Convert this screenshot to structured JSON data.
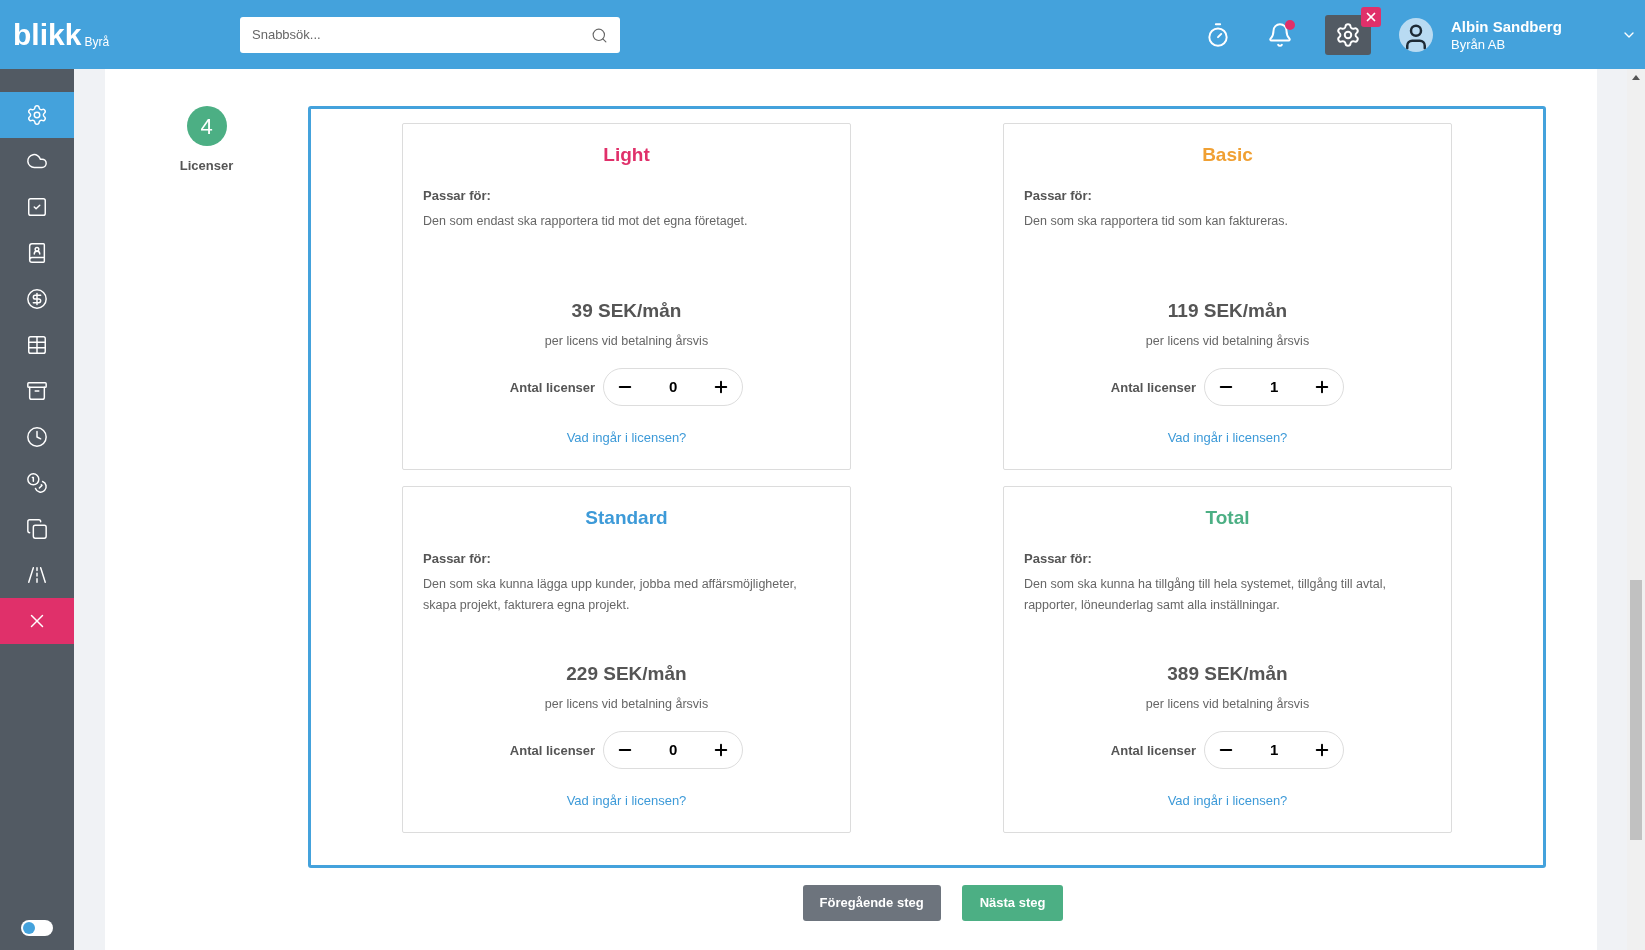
{
  "header": {
    "logo": "blikk",
    "logo_suffix": "Byrå",
    "search": {
      "placeholder": "Snabbsök..."
    },
    "notifications_unread": true,
    "settings_active": true,
    "user": {
      "name": "Albin Sandberg",
      "company": "Byrån AB"
    }
  },
  "sidebar": {
    "items": [
      {
        "kind": "settings",
        "selected": true
      },
      {
        "kind": "cloud",
        "selected": false
      },
      {
        "kind": "task",
        "selected": false
      },
      {
        "kind": "contacts",
        "selected": false
      },
      {
        "kind": "money",
        "selected": false
      },
      {
        "kind": "table",
        "selected": false
      },
      {
        "kind": "archive",
        "selected": false
      },
      {
        "kind": "clock",
        "selected": false
      },
      {
        "kind": "coins",
        "selected": false
      },
      {
        "kind": "copy",
        "selected": false
      },
      {
        "kind": "road",
        "selected": false
      },
      {
        "kind": "close",
        "selected": false
      }
    ],
    "toggle": {
      "on": false
    }
  },
  "step": {
    "number": "4",
    "label": "Licenser"
  },
  "plans": [
    {
      "name": "Light",
      "color": "#e0306a",
      "fit_label": "Passar för:",
      "description": "Den som endast ska rapportera tid mot det egna företaget.",
      "price": "39 SEK/mån",
      "note": "per licens vid betalning årsvis",
      "quantity_label": "Antal licenser",
      "quantity": "0",
      "link": "Vad ingår i licensen?"
    },
    {
      "name": "Basic",
      "color": "#f0a033",
      "fit_label": "Passar för:",
      "description": "Den som ska rapportera tid som kan faktureras.",
      "price": "119 SEK/mån",
      "note": "per licens vid betalning årsvis",
      "quantity_label": "Antal licenser",
      "quantity": "1",
      "link": "Vad ingår i licensen?"
    },
    {
      "name": "Standard",
      "color": "#3d9ad8",
      "fit_label": "Passar för:",
      "description": "Den som ska kunna lägga upp kunder, jobba med affärsmöjligheter, skapa projekt, fakturera egna projekt.",
      "price": "229 SEK/mån",
      "note": "per licens vid betalning årsvis",
      "quantity_label": "Antal licenser",
      "quantity": "0",
      "link": "Vad ingår i licensen?"
    },
    {
      "name": "Total",
      "color": "#4caf84",
      "fit_label": "Passar för:",
      "description": "Den som ska kunna ha tillgång till hela systemet, tillgång till avtal, rapporter, löneunderlag samt alla inställningar.",
      "price": "389 SEK/mån",
      "note": "per licens vid betalning årsvis",
      "quantity_label": "Antal licenser",
      "quantity": "1",
      "link": "Vad ingår i licensen?"
    }
  ],
  "buttons": {
    "previous": "Föregående steg",
    "next": "Nästa steg"
  }
}
